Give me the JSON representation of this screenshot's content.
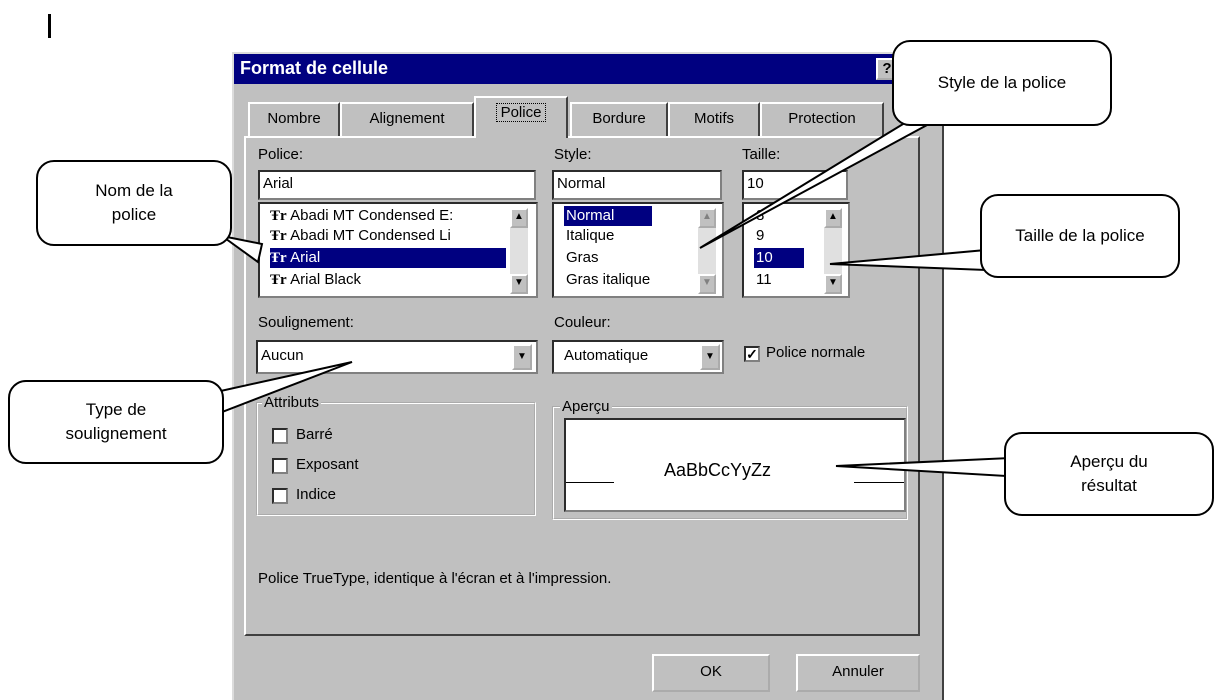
{
  "dialog": {
    "title": "Format de cellule",
    "help_icon": "?",
    "tabs": [
      "Nombre",
      "Alignement",
      "Police",
      "Bordure",
      "Motifs",
      "Protection"
    ],
    "font": {
      "label": "Police:",
      "value": "Arial",
      "items": [
        "Abadi MT Condensed E:",
        "Abadi MT Condensed Li",
        "Arial",
        "Arial Black"
      ],
      "item_icon": "truetype-icon"
    },
    "style": {
      "label": "Style:",
      "value": "Normal",
      "items": [
        "Normal",
        "Italique",
        "Gras",
        "Gras italique"
      ]
    },
    "size": {
      "label": "Taille:",
      "value": "10",
      "items": [
        "8",
        "9",
        "10",
        "11"
      ]
    },
    "underline": {
      "label": "Soulignement:",
      "value": "Aucun"
    },
    "color": {
      "label": "Couleur:",
      "value": "Automatique"
    },
    "normal_font": {
      "label": "Police normale",
      "checked": true
    },
    "attributes": {
      "label": "Attributs",
      "items": [
        "Barré",
        "Exposant",
        "Indice"
      ]
    },
    "preview": {
      "label": "Aperçu",
      "text": "AaBbCcYyZz"
    },
    "info": "Police TrueType, identique à l'écran et à l'impression.",
    "ok": "OK",
    "cancel": "Annuler"
  },
  "callouts": {
    "font_name": "Nom de la police",
    "font_style": "Style de la police",
    "font_size": "Taille de la police",
    "underline_type": "Type de soulignement",
    "preview_result": "Aperçu du résultat"
  },
  "colors": {
    "titlebar": "#000080",
    "dialog": "#c0c0c0",
    "selection": "#000080"
  }
}
